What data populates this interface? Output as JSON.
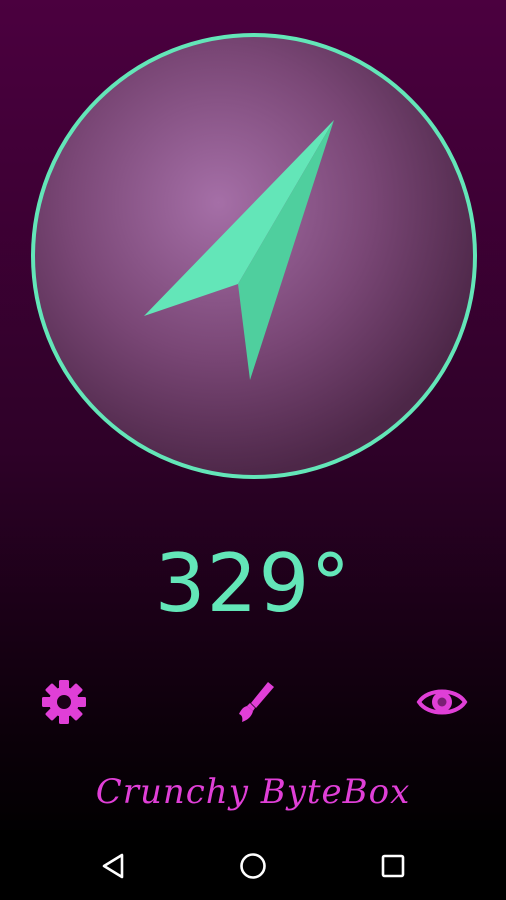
{
  "compass": {
    "heading_text": "329°",
    "heading_degrees": 329
  },
  "toolbar": {
    "settings_icon": "gear-icon",
    "theme_icon": "paintbrush-icon",
    "view_icon": "eye-icon"
  },
  "branding": {
    "text": "Crunchy ByteBox"
  },
  "system_nav": {
    "back_icon": "back-triangle-icon",
    "home_icon": "home-circle-icon",
    "recents_icon": "recents-square-icon"
  },
  "colors": {
    "accent": "#63e6b8",
    "accent_dark": "#4fcf9e",
    "brand_pink": "#e03fd7",
    "dial_center": "#a56fa7",
    "dial_edge": "#4d2748",
    "background_top": "#4b003f",
    "background_bottom": "#000000"
  }
}
